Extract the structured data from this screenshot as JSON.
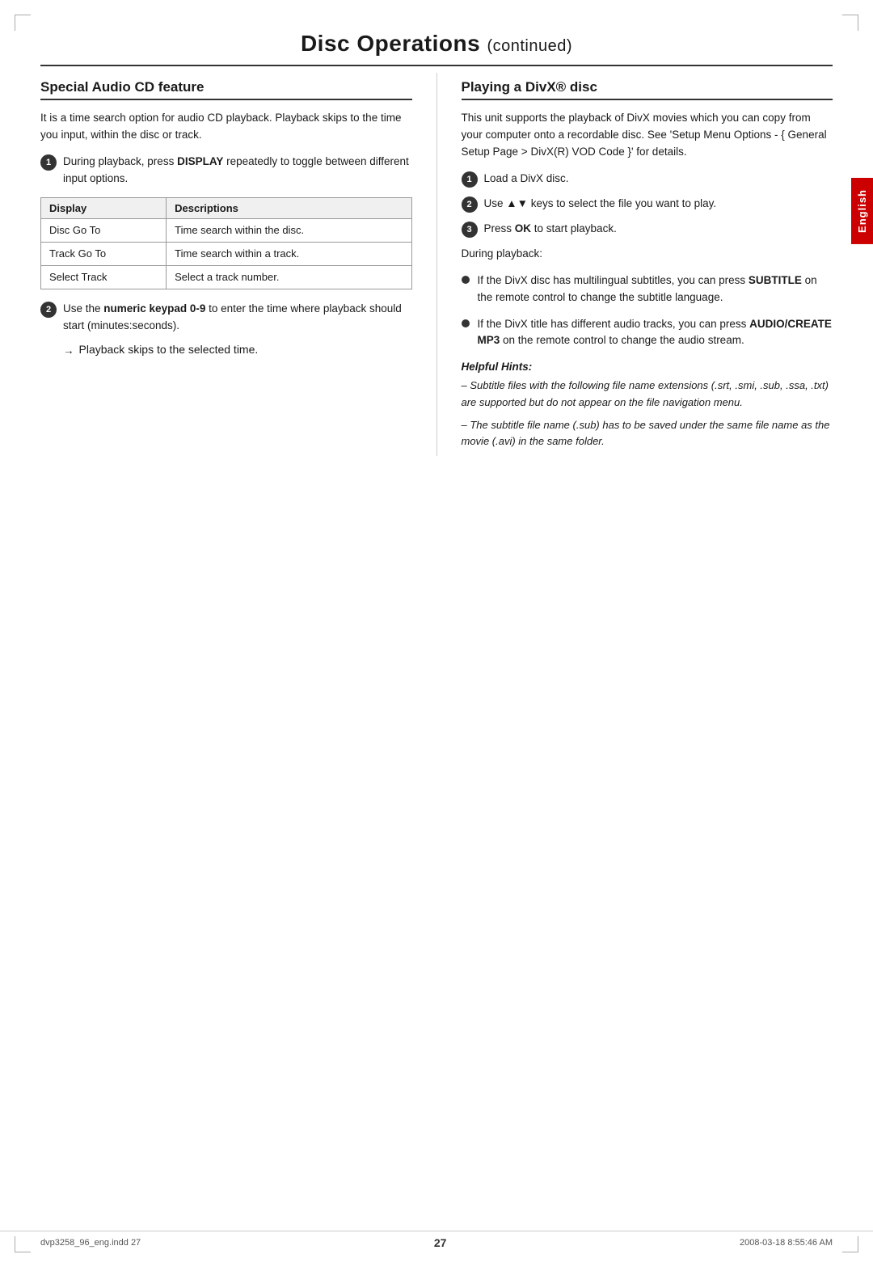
{
  "page": {
    "title": "Disc Operations",
    "title_continued": "(continued)"
  },
  "left_section": {
    "heading": "Special Audio CD feature",
    "intro": "It is a time search option for audio CD playback. Playback skips to the time you input, within the disc or track.",
    "step1": {
      "number": "1",
      "text_before_bold": "During playback, press ",
      "bold_text": "DISPLAY",
      "text_after": " repeatedly to toggle between different input options."
    },
    "table": {
      "col1_header": "Display",
      "col2_header": "Descriptions",
      "rows": [
        {
          "display": "Disc Go To",
          "description": "Time search within the disc."
        },
        {
          "display": "Track Go To",
          "description": "Time search within a track."
        },
        {
          "display": "Select Track",
          "description": "Select a track number."
        }
      ]
    },
    "step2": {
      "number": "2",
      "text_before_bold": "Use the ",
      "bold_text": "numeric keypad 0-9",
      "text_after": " to enter the time where playback should start (minutes:seconds)."
    },
    "sub_step": {
      "arrow": "→",
      "text": "Playback skips to the selected time."
    }
  },
  "right_section": {
    "heading": "Playing a DivX® disc",
    "intro": "This unit supports the playback of DivX movies which you can copy from your computer onto a recordable disc. See 'Setup Menu Options - { General Setup Page > DivX(R) VOD Code }' for details.",
    "step1": {
      "number": "1",
      "text": "Load a DivX disc."
    },
    "step2": {
      "number": "2",
      "text_before": "Use ",
      "triangle_up": "▲",
      "triangle_down": "▼",
      "text_after": " keys to select the file you want to play."
    },
    "step3": {
      "number": "3",
      "text_before": "Press ",
      "bold_text": "OK",
      "text_after": " to start playback."
    },
    "during_playback_label": "During playback:",
    "bullet1": {
      "text_before": "If the DivX disc has multilingual subtitles, you can press ",
      "bold_text": "SUBTITLE",
      "text_after": " on the remote control to change the subtitle language."
    },
    "bullet2": {
      "text_before": "If the DivX title has different audio tracks, you can press ",
      "bold_text1": "AUDIO/CREATE",
      "bold_text2": "MP3",
      "text_middle": " on the remote control to change the audio stream."
    },
    "helpful_hints": {
      "title": "Helpful Hints:",
      "hint1": "– Subtitle files with the following file name extensions (.srt, .smi, .sub, .ssa, .txt) are supported but do not appear on the file navigation menu.",
      "hint2": "– The subtitle file name (.sub) has to be saved under the same file name as the movie (.avi) in the same folder."
    }
  },
  "language_tab": {
    "text": "English"
  },
  "footer": {
    "left": "dvp3258_96_eng.indd   27",
    "page": "27",
    "right": "2008-03-18   8:55:46 AM"
  }
}
